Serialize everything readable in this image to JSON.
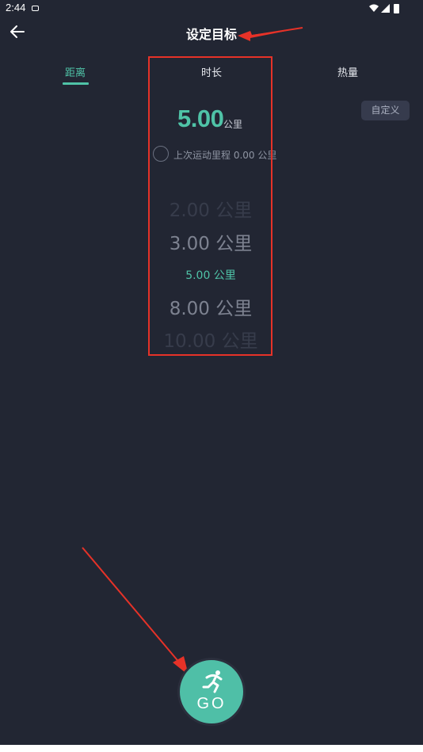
{
  "status_bar": {
    "time": "2:44"
  },
  "app_bar": {
    "title": "设定目标"
  },
  "tabs": [
    {
      "label": "距离",
      "active": true
    },
    {
      "label": "时长",
      "active": false
    },
    {
      "label": "热量",
      "active": false
    }
  ],
  "custom_button": "自定义",
  "current_target": {
    "value": "5.00",
    "unit": "公里"
  },
  "last_record": "上次运动里程 0.00 公里",
  "picker_options": [
    "2.00 公里",
    "3.00 公里",
    "5.00 公里",
    "8.00 公里",
    "10.00 公里"
  ],
  "selected_option": "5.00 公里",
  "go_button": "GO",
  "colors": {
    "accent": "#4fc3a7",
    "background": "#222633",
    "annotation": "#e63228"
  },
  "icons": [
    "back-arrow-icon",
    "wifi-icon",
    "signal-icon",
    "battery-icon",
    "runner-icon"
  ]
}
